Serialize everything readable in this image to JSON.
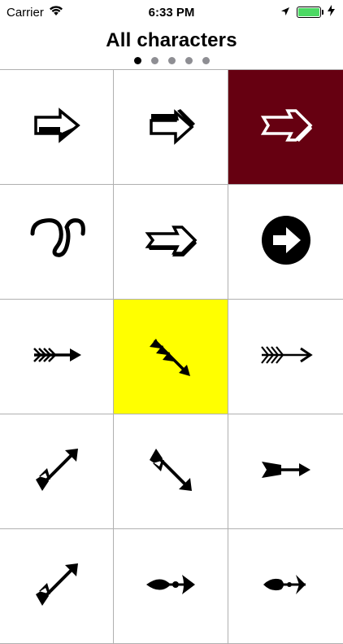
{
  "status": {
    "carrier": "Carrier",
    "time": "6:33 PM",
    "battery_percent": 100,
    "battery_color": "#4cd964"
  },
  "header": {
    "title": "All characters",
    "page_count": 5,
    "current_page": 1
  },
  "grid": {
    "cells": [
      {
        "icon": "black-notched-arrow-icon",
        "background": "#ffffff"
      },
      {
        "icon": "white-flag-arrow-icon",
        "background": "#ffffff"
      },
      {
        "icon": "white-outlined-arrow-icon",
        "background": "#660011"
      },
      {
        "icon": "loop-icon",
        "background": "#ffffff"
      },
      {
        "icon": "notched-outline-arrow-icon",
        "background": "#ffffff"
      },
      {
        "icon": "circled-arrow-icon",
        "background": "#ffffff"
      },
      {
        "icon": "feathered-arrow-icon",
        "background": "#ffffff"
      },
      {
        "icon": "diagonal-feathered-arrow-icon",
        "background": "#ffff00"
      },
      {
        "icon": "long-feathered-arrow-icon",
        "background": "#ffffff"
      },
      {
        "icon": "up-right-arrow-icon",
        "background": "#ffffff"
      },
      {
        "icon": "down-right-arrow-icon",
        "background": "#ffffff"
      },
      {
        "icon": "heavy-right-arrow-icon",
        "background": "#ffffff"
      },
      {
        "icon": "up-right-arrow-icon",
        "background": "#ffffff"
      },
      {
        "icon": "fleur-arrow-icon",
        "background": "#ffffff"
      },
      {
        "icon": "drop-arrow-icon",
        "background": "#ffffff"
      }
    ]
  }
}
